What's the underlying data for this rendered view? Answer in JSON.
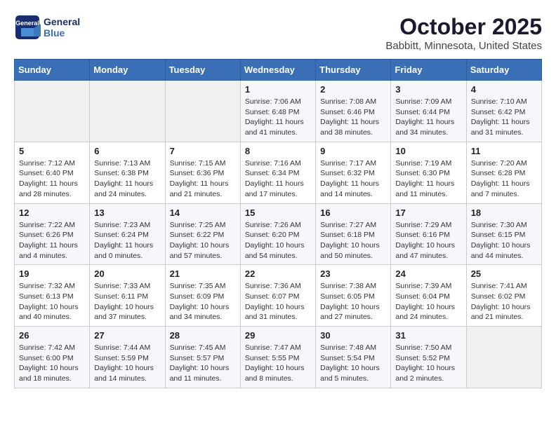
{
  "logo": {
    "general": "General",
    "blue": "Blue"
  },
  "title": "October 2025",
  "location": "Babbitt, Minnesota, United States",
  "weekdays": [
    "Sunday",
    "Monday",
    "Tuesday",
    "Wednesday",
    "Thursday",
    "Friday",
    "Saturday"
  ],
  "weeks": [
    [
      {
        "day": "",
        "info": ""
      },
      {
        "day": "",
        "info": ""
      },
      {
        "day": "",
        "info": ""
      },
      {
        "day": "1",
        "info": "Sunrise: 7:06 AM\nSunset: 6:48 PM\nDaylight: 11 hours and 41 minutes."
      },
      {
        "day": "2",
        "info": "Sunrise: 7:08 AM\nSunset: 6:46 PM\nDaylight: 11 hours and 38 minutes."
      },
      {
        "day": "3",
        "info": "Sunrise: 7:09 AM\nSunset: 6:44 PM\nDaylight: 11 hours and 34 minutes."
      },
      {
        "day": "4",
        "info": "Sunrise: 7:10 AM\nSunset: 6:42 PM\nDaylight: 11 hours and 31 minutes."
      }
    ],
    [
      {
        "day": "5",
        "info": "Sunrise: 7:12 AM\nSunset: 6:40 PM\nDaylight: 11 hours and 28 minutes."
      },
      {
        "day": "6",
        "info": "Sunrise: 7:13 AM\nSunset: 6:38 PM\nDaylight: 11 hours and 24 minutes."
      },
      {
        "day": "7",
        "info": "Sunrise: 7:15 AM\nSunset: 6:36 PM\nDaylight: 11 hours and 21 minutes."
      },
      {
        "day": "8",
        "info": "Sunrise: 7:16 AM\nSunset: 6:34 PM\nDaylight: 11 hours and 17 minutes."
      },
      {
        "day": "9",
        "info": "Sunrise: 7:17 AM\nSunset: 6:32 PM\nDaylight: 11 hours and 14 minutes."
      },
      {
        "day": "10",
        "info": "Sunrise: 7:19 AM\nSunset: 6:30 PM\nDaylight: 11 hours and 11 minutes."
      },
      {
        "day": "11",
        "info": "Sunrise: 7:20 AM\nSunset: 6:28 PM\nDaylight: 11 hours and 7 minutes."
      }
    ],
    [
      {
        "day": "12",
        "info": "Sunrise: 7:22 AM\nSunset: 6:26 PM\nDaylight: 11 hours and 4 minutes."
      },
      {
        "day": "13",
        "info": "Sunrise: 7:23 AM\nSunset: 6:24 PM\nDaylight: 11 hours and 0 minutes."
      },
      {
        "day": "14",
        "info": "Sunrise: 7:25 AM\nSunset: 6:22 PM\nDaylight: 10 hours and 57 minutes."
      },
      {
        "day": "15",
        "info": "Sunrise: 7:26 AM\nSunset: 6:20 PM\nDaylight: 10 hours and 54 minutes."
      },
      {
        "day": "16",
        "info": "Sunrise: 7:27 AM\nSunset: 6:18 PM\nDaylight: 10 hours and 50 minutes."
      },
      {
        "day": "17",
        "info": "Sunrise: 7:29 AM\nSunset: 6:16 PM\nDaylight: 10 hours and 47 minutes."
      },
      {
        "day": "18",
        "info": "Sunrise: 7:30 AM\nSunset: 6:15 PM\nDaylight: 10 hours and 44 minutes."
      }
    ],
    [
      {
        "day": "19",
        "info": "Sunrise: 7:32 AM\nSunset: 6:13 PM\nDaylight: 10 hours and 40 minutes."
      },
      {
        "day": "20",
        "info": "Sunrise: 7:33 AM\nSunset: 6:11 PM\nDaylight: 10 hours and 37 minutes."
      },
      {
        "day": "21",
        "info": "Sunrise: 7:35 AM\nSunset: 6:09 PM\nDaylight: 10 hours and 34 minutes."
      },
      {
        "day": "22",
        "info": "Sunrise: 7:36 AM\nSunset: 6:07 PM\nDaylight: 10 hours and 31 minutes."
      },
      {
        "day": "23",
        "info": "Sunrise: 7:38 AM\nSunset: 6:05 PM\nDaylight: 10 hours and 27 minutes."
      },
      {
        "day": "24",
        "info": "Sunrise: 7:39 AM\nSunset: 6:04 PM\nDaylight: 10 hours and 24 minutes."
      },
      {
        "day": "25",
        "info": "Sunrise: 7:41 AM\nSunset: 6:02 PM\nDaylight: 10 hours and 21 minutes."
      }
    ],
    [
      {
        "day": "26",
        "info": "Sunrise: 7:42 AM\nSunset: 6:00 PM\nDaylight: 10 hours and 18 minutes."
      },
      {
        "day": "27",
        "info": "Sunrise: 7:44 AM\nSunset: 5:59 PM\nDaylight: 10 hours and 14 minutes."
      },
      {
        "day": "28",
        "info": "Sunrise: 7:45 AM\nSunset: 5:57 PM\nDaylight: 10 hours and 11 minutes."
      },
      {
        "day": "29",
        "info": "Sunrise: 7:47 AM\nSunset: 5:55 PM\nDaylight: 10 hours and 8 minutes."
      },
      {
        "day": "30",
        "info": "Sunrise: 7:48 AM\nSunset: 5:54 PM\nDaylight: 10 hours and 5 minutes."
      },
      {
        "day": "31",
        "info": "Sunrise: 7:50 AM\nSunset: 5:52 PM\nDaylight: 10 hours and 2 minutes."
      },
      {
        "day": "",
        "info": ""
      }
    ]
  ]
}
